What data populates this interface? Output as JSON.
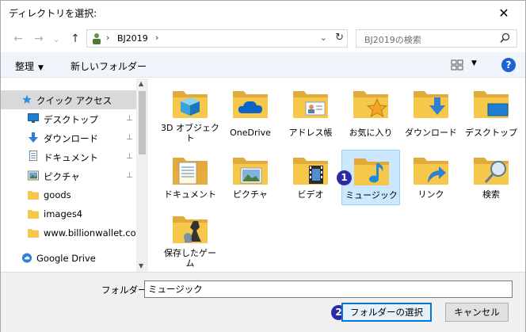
{
  "window": {
    "title": "ディレクトリを選択:",
    "close_glyph": "✕"
  },
  "navigation": {
    "back_glyph": "←",
    "forward_glyph": "→",
    "recent_glyph": "⌄",
    "up_glyph": "↑",
    "address": {
      "chevron": "›",
      "path": "BJ2019",
      "dropdown_glyph": "⌄",
      "refresh_glyph": "↻"
    },
    "search": {
      "placeholder": "BJ2019の検索",
      "icon": "search-icon"
    }
  },
  "toolbar": {
    "organize_label": "整理",
    "organize_caret": "▼",
    "new_folder_label": "新しいフォルダー",
    "view_caret": "▼",
    "help_label": "?"
  },
  "sidebar": {
    "items": [
      {
        "label": "クイック アクセス",
        "icon": "star-icon",
        "selected": true,
        "pinned": false
      },
      {
        "label": "デスクトップ",
        "icon": "desktop-icon",
        "pinned": true
      },
      {
        "label": "ダウンロード",
        "icon": "download-icon",
        "pinned": true
      },
      {
        "label": "ドキュメント",
        "icon": "document-icon",
        "pinned": true
      },
      {
        "label": "ピクチャ",
        "icon": "picture-icon",
        "pinned": true
      },
      {
        "label": "goods",
        "icon": "folder-icon",
        "pinned": false
      },
      {
        "label": "images4",
        "icon": "folder-icon",
        "pinned": false
      },
      {
        "label": "www.billionwallet.com",
        "icon": "folder-icon",
        "pinned": false
      },
      {
        "label": "Google Drive",
        "icon": "google-drive-icon",
        "pinned": false
      }
    ],
    "pin_glyph": "📌"
  },
  "folders": [
    {
      "label": "3D オブジェクト",
      "overlay": "3d-cube"
    },
    {
      "label": "OneDrive",
      "overlay": "cloud"
    },
    {
      "label": "アドレス帳",
      "overlay": "contact-card"
    },
    {
      "label": "お気に入り",
      "overlay": "star"
    },
    {
      "label": "ダウンロード",
      "overlay": "download-arrow"
    },
    {
      "label": "デスクトップ",
      "overlay": "monitor"
    },
    {
      "label": "ドキュメント",
      "overlay": "document"
    },
    {
      "label": "ピクチャ",
      "overlay": "picture"
    },
    {
      "label": "ビデオ",
      "overlay": "film"
    },
    {
      "label": "ミュージック",
      "overlay": "music-note",
      "selected": true
    },
    {
      "label": "リンク",
      "overlay": "link-arrow"
    },
    {
      "label": "検索",
      "overlay": "magnifier"
    },
    {
      "label": "保存したゲーム",
      "overlay": "chess-piece"
    }
  ],
  "badges": {
    "one": "1",
    "two": "2"
  },
  "footer": {
    "folder_label": "フォルダー:",
    "folder_value": "ミュージック",
    "select_button": "フォルダーの選択",
    "cancel_button": "キャンセル"
  },
  "colors": {
    "folder": "#f5c84c",
    "folder_dark": "#e2a93b",
    "selection_bg": "#cce8ff",
    "accent": "#0078d7",
    "badge": "#2b2ba4"
  }
}
